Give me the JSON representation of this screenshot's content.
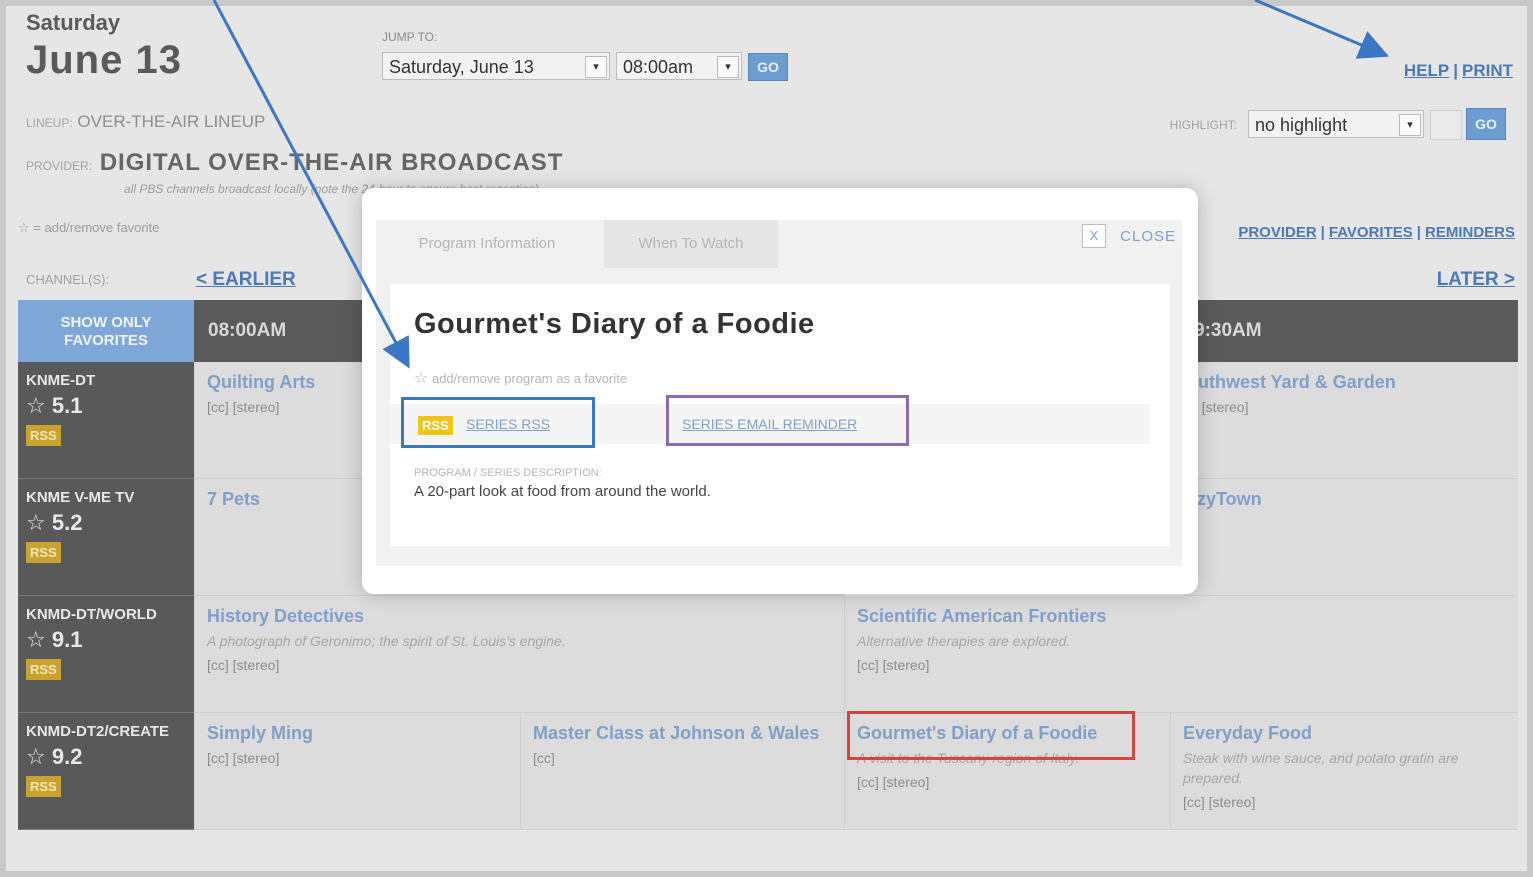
{
  "header": {
    "day_name": "Saturday",
    "date": "June 13",
    "jump_to_label": "JUMP TO:",
    "date_select": "Saturday, June 13",
    "time_select": "08:00am",
    "go_label": "GO",
    "help_link": "HELP",
    "print_link": "PRINT",
    "separator": "|"
  },
  "lineup": {
    "label": "LINEUP:",
    "value": "OVER-THE-AIR LINEUP",
    "provider_label": "PROVIDER:",
    "provider_value": "DIGITAL OVER-THE-AIR BROADCAST",
    "provider_note": "all PBS channels broadcast locally (note the 24-hour to ensure best reception)"
  },
  "highlight": {
    "label": "HIGHLIGHT:",
    "value": "no highlight",
    "go_label": "GO"
  },
  "legend": {
    "favorites": "= add/remove favorite"
  },
  "filters": {
    "provider": "PROVIDER",
    "favorites": "FAVORITES",
    "reminders": "REMINDERS"
  },
  "nav": {
    "channels_label": "CHANNEL(S):",
    "earlier": "< EARLIER",
    "later": "LATER >"
  },
  "grid": {
    "show_only_favorites": "SHOW ONLY FAVORITES",
    "times": [
      "08:00AM",
      "9:30AM"
    ],
    "rss_badge": "RSS",
    "channels": [
      {
        "name": "KNME-DT",
        "number": "5.1"
      },
      {
        "name": "KNME V-ME TV",
        "number": "5.2"
      },
      {
        "name": "KNMD-DT/WORLD",
        "number": "9.1"
      },
      {
        "name": "KNMD-DT2/CREATE",
        "number": "9.2"
      }
    ],
    "programs": {
      "quilting_arts": {
        "title": "Quilting Arts",
        "flags": "[cc] [stereo]"
      },
      "southwest": {
        "title": "outhwest Yard & Garden",
        "flags": "c] [stereo]"
      },
      "pets": {
        "title": "7 Pets"
      },
      "lazytown": {
        "title": "azyTown"
      },
      "history": {
        "title": "History Detectives",
        "desc": "A photograph of Geronimo; the spirit of St. Louis's engine.",
        "flags": "[cc] [stereo]"
      },
      "sci_am": {
        "title": "Scientific American Frontiers",
        "desc": "Alternative therapies are explored.",
        "flags": "[cc] [stereo]"
      },
      "ming": {
        "title": "Simply Ming",
        "flags": "[cc] [stereo]"
      },
      "master_class": {
        "title": "Master Class at Johnson & Wales",
        "flags": "[cc]"
      },
      "gourmet": {
        "title": "Gourmet's Diary of a Foodie",
        "desc": "A visit to the Tuscany region of Italy.",
        "flags": "[cc] [stereo]"
      },
      "everyday": {
        "title": "Everyday Food",
        "desc": "Steak with wine sauce, and potato gratin are prepared.",
        "flags": "[cc] [stereo]"
      }
    }
  },
  "modal": {
    "tab_info": "Program Information",
    "tab_watch": "When To Watch",
    "close_x": "X",
    "close_label": "CLOSE",
    "title": "Gourmet's Diary of a Foodie",
    "fav_text": "add/remove program as a favorite",
    "rss_badge": "RSS",
    "series_rss": "SERIES RSS",
    "series_email": "SERIES EMAIL REMINDER",
    "desc_label": "PROGRAM / SERIES DESCRIPTION:",
    "desc": "A 20-part look at food from around the world."
  },
  "colors": {
    "annotation_blue": "#3b77c4",
    "annotation_purple": "#8b6bb3",
    "annotation_red": "#d1473d",
    "link_blue": "#4a7ab8",
    "rss_gold": "#f0c419"
  }
}
